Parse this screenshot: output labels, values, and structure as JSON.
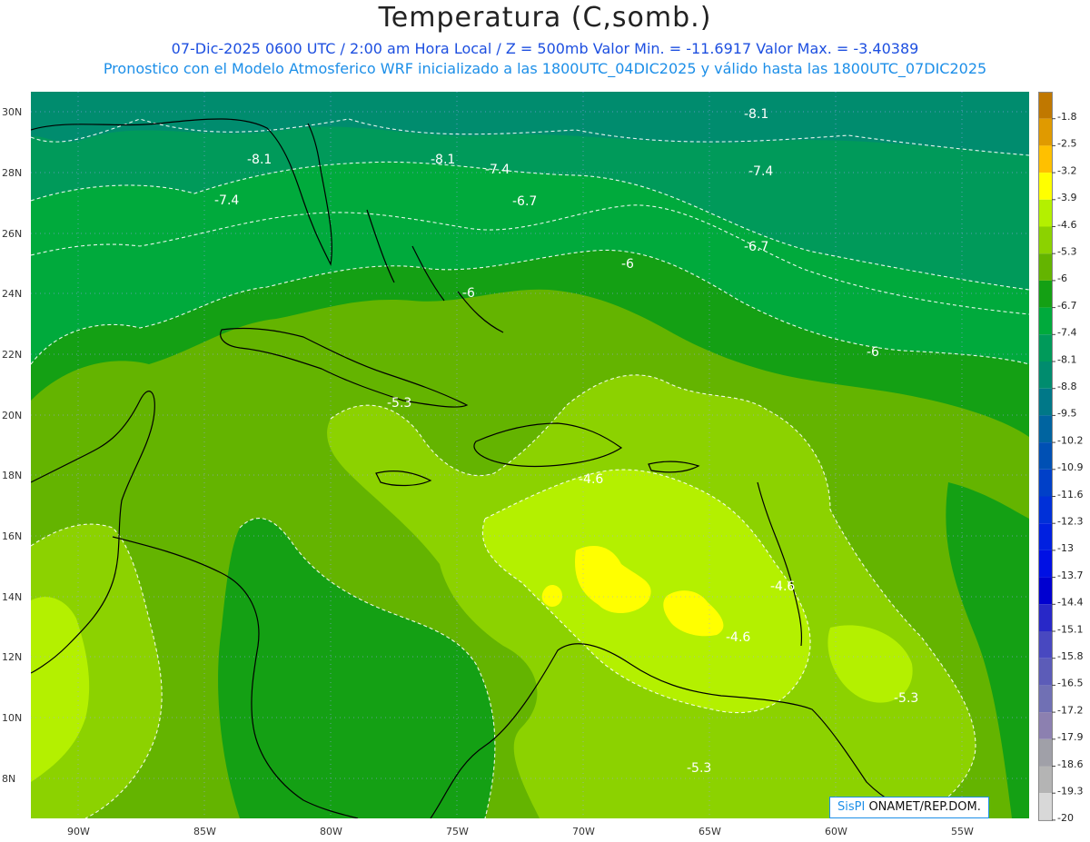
{
  "header": {
    "title": "Temperatura (C,somb.)",
    "line1": "07-Dic-2025   0600 UTC / 2:00 am Hora Local / Z = 500mb  Valor Min. = -11.6917  Valor Max. = -3.40389",
    "line2": "Pronostico con el Modelo Atmosferico WRF inicializado a las 1800UTC_04DIC2025 y válido hasta las  1800UTC_07DIC2025"
  },
  "map": {
    "lat_labels": [
      "30N",
      "28N",
      "26N",
      "24N",
      "22N",
      "20N",
      "18N",
      "16N",
      "14N",
      "12N",
      "10N",
      "8N"
    ],
    "lon_labels": [
      "90W",
      "85W",
      "80W",
      "75W",
      "70W",
      "65W",
      "60W",
      "55W"
    ],
    "contour_labels": [
      "-8.1",
      "-8.1",
      "-8.1",
      "-7.4",
      "-7.4",
      "-7.4",
      "-6.7",
      "-6.7",
      "-6",
      "-6",
      "-6",
      "-5.3",
      "-5.3",
      "-5.3",
      "-4.6",
      "-4.6",
      "-4.6"
    ]
  },
  "colorbar": {
    "labels": [
      "-1.8",
      "-2.5",
      "-3.2",
      "-3.9",
      "-4.6",
      "-5.3",
      "-6",
      "-6.7",
      "-7.4",
      "-8.1",
      "-8.8",
      "-9.5",
      "-10.2",
      "-10.9",
      "-11.6",
      "-12.3",
      "-13",
      "-13.7",
      "-14.4",
      "-15.1",
      "-15.8",
      "-16.5",
      "-17.2",
      "-17.9",
      "-18.6",
      "-19.3",
      "-20"
    ],
    "colors": [
      "#c07800",
      "#e09a00",
      "#ffc000",
      "#ffff00",
      "#b4f000",
      "#8cd200",
      "#64b400",
      "#14a014",
      "#00aa3c",
      "#009a5a",
      "#008c6e",
      "#007888",
      "#0064a0",
      "#0050b4",
      "#0040c8",
      "#0030d8",
      "#0020e0",
      "#0010e4",
      "#0000d0",
      "#2828c8",
      "#4848c0",
      "#5c5cb8",
      "#7070b4",
      "#8c80b0",
      "#a0a0a8",
      "#b4b4b4",
      "#d8d8d8"
    ]
  },
  "credit": {
    "brand": "SisPI",
    "text": " ONAMET/REP.DOM."
  },
  "palette": {
    "band_8_1": "#008c6e",
    "band_7_4": "#009a5a",
    "band_6_7": "#00aa3c",
    "band_6": "#14a014",
    "band_5_3": "#64b400",
    "band_4_6": "#8cd200",
    "band_3_9": "#b4f000",
    "band_3_2": "#ffff00"
  }
}
